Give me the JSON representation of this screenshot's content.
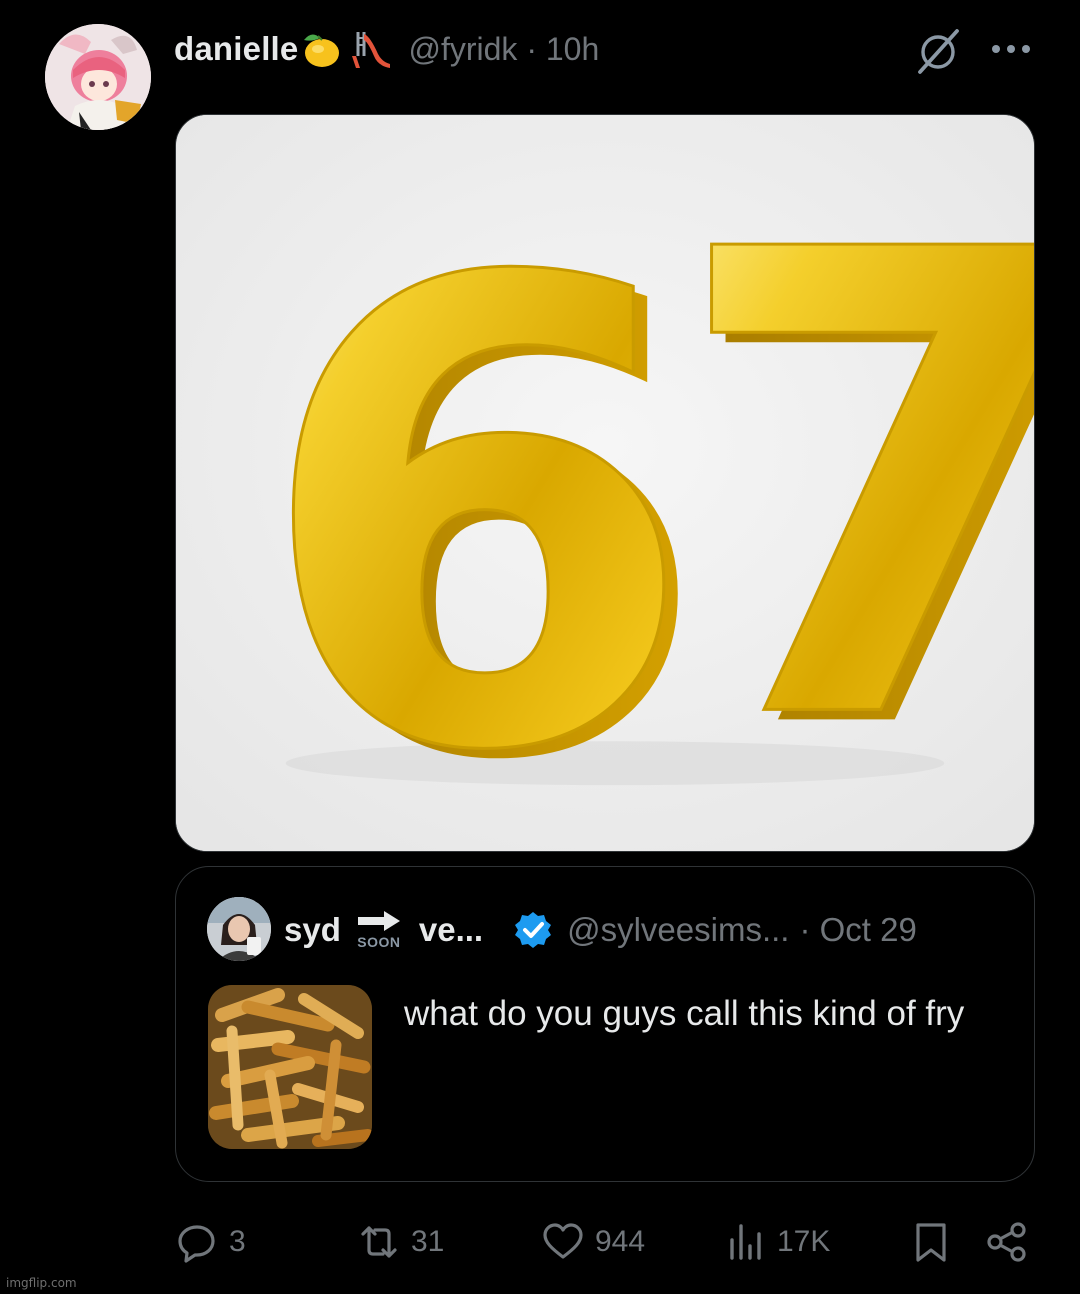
{
  "post": {
    "display_name": "danielle",
    "emoji_1": "lemon-emoji",
    "emoji_2": "slide-emoji",
    "handle_time": "@fyridk · 10h",
    "media": {
      "digits": "67",
      "description_icon": "gold-number-image"
    },
    "icons": {
      "grok": "grok-icon",
      "more": "more-icon"
    }
  },
  "quote": {
    "display_name": "syd",
    "soon_label": "SOON",
    "display_name_tail": "ve...",
    "handle": "@sylveesims...",
    "date": "· Oct 29",
    "text": "what do you guys call this kind of fry",
    "thumbnail": "fries-image",
    "verified_color": "#1d9bf0"
  },
  "actions": {
    "reply_count": "3",
    "repost_count": "31",
    "like_count": "944",
    "views_count": "17K"
  },
  "colors": {
    "background": "#000000",
    "text_primary": "#e7e9ea",
    "text_secondary": "#71767b",
    "border": "#2f3336",
    "gold": "#e6b400"
  },
  "watermark": "imgflip.com"
}
